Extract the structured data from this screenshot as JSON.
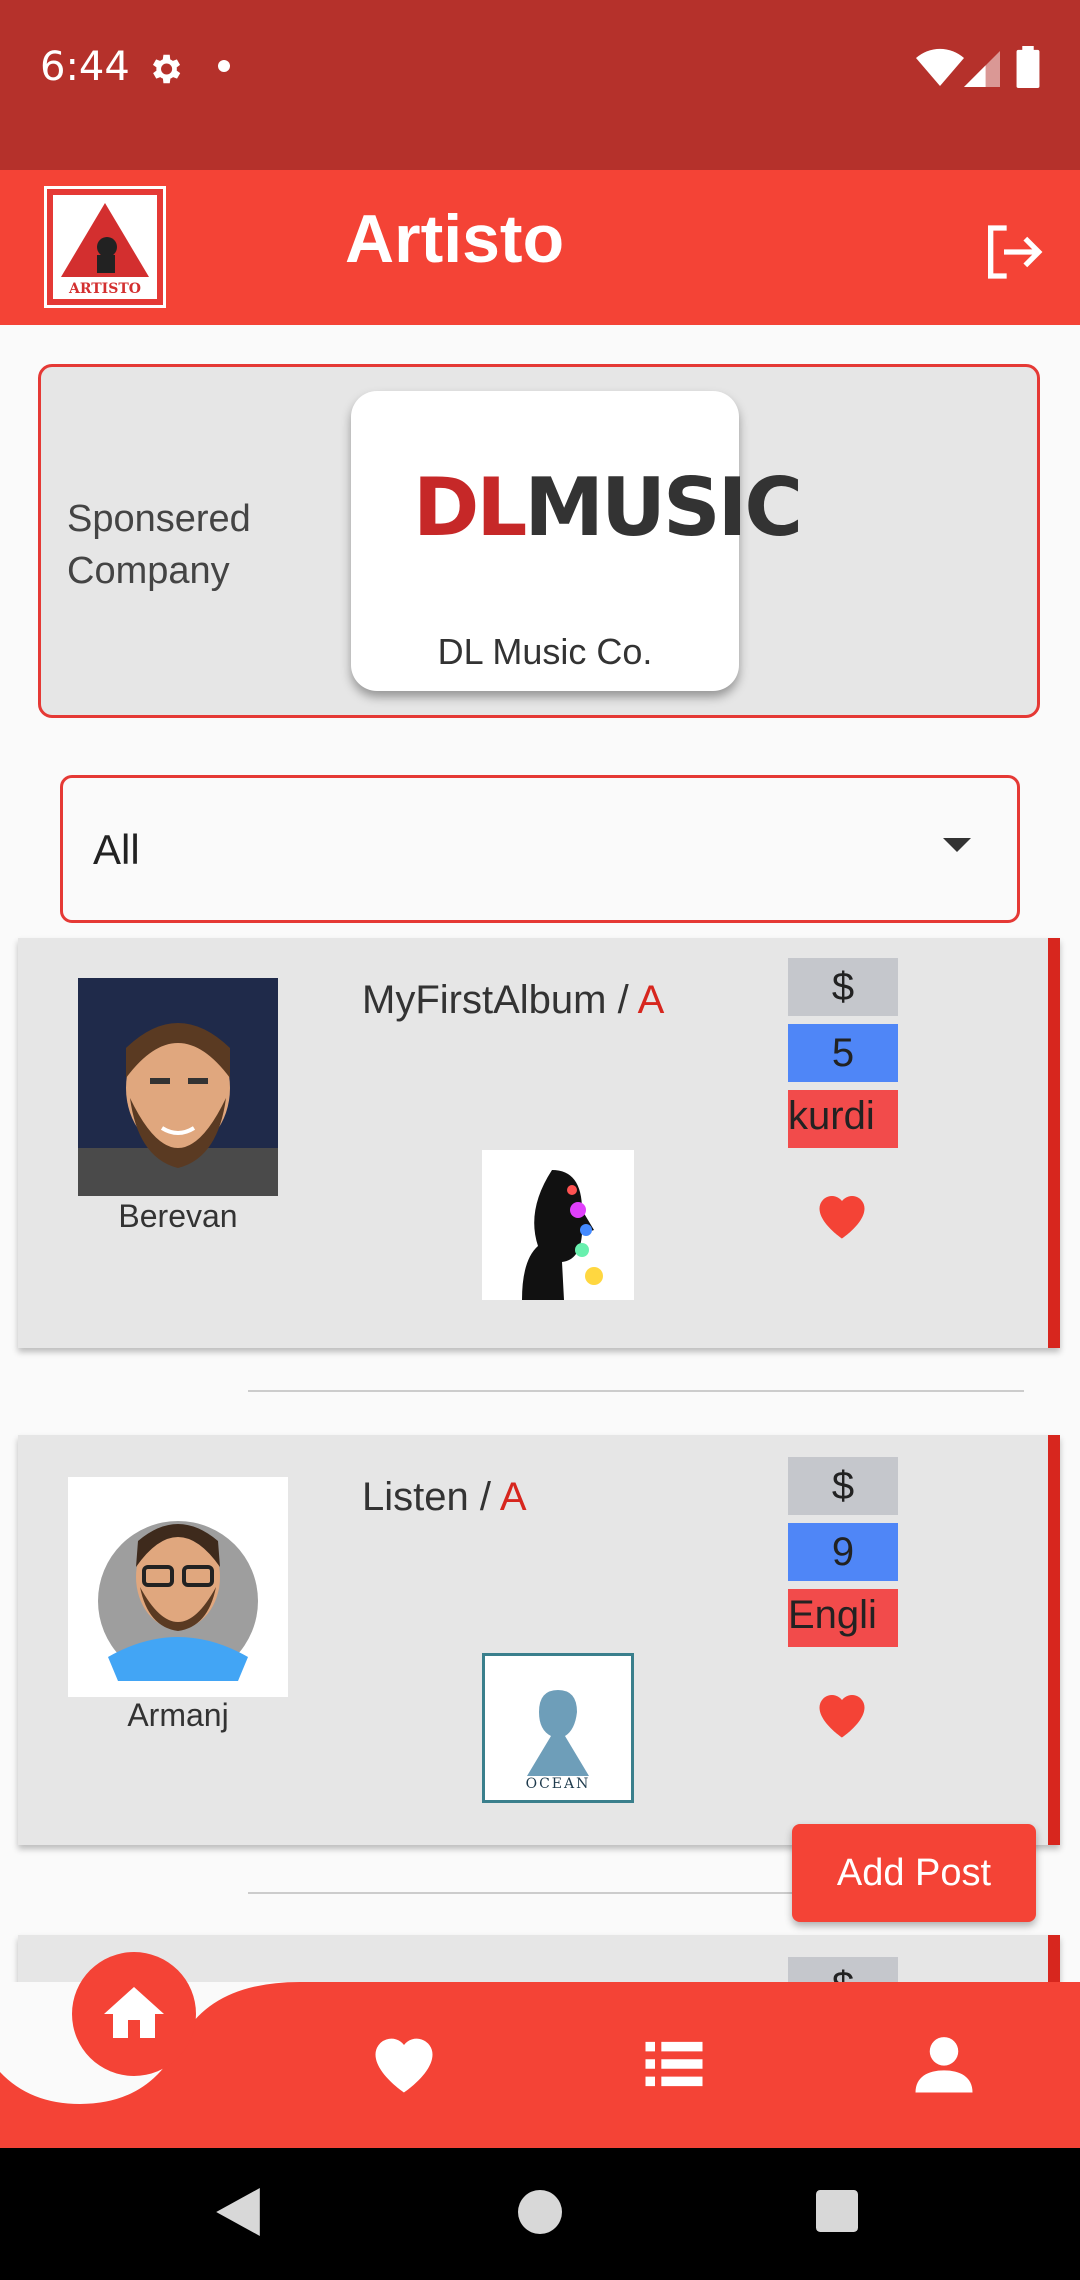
{
  "status_bar": {
    "time": "6:44"
  },
  "app_bar": {
    "title": "Artisto",
    "logo_text": "ARTISTO"
  },
  "sponsor": {
    "label": "Sponsered Company",
    "company_logo_text_dl": "DL",
    "company_logo_text_music": "MUSIC",
    "company_name": "DL Music Co."
  },
  "filter": {
    "selected": "All"
  },
  "posts": [
    {
      "author": "Berevan",
      "title": "MyFirstAlbum / ",
      "grade": "A",
      "price_symbol": "$",
      "count": "5",
      "language": "kurdi"
    },
    {
      "author": "Armanj",
      "title": "Listen / ",
      "grade": "A",
      "price_symbol": "$",
      "count": "9",
      "language": "Engli"
    },
    {
      "author": "",
      "title": "",
      "grade": "",
      "price_symbol": "$",
      "count": "",
      "language": ""
    }
  ],
  "fab": {
    "label": "Add Post"
  },
  "colors": {
    "primary": "#f44336",
    "status": "#b5312b",
    "accent_red": "#d7261e",
    "count_blue": "#4f86f7"
  },
  "icons": {
    "settings": "settings-icon",
    "logout": "logout-icon",
    "home": "home-icon",
    "favorites": "heart-icon",
    "list": "list-icon",
    "profile": "person-icon"
  }
}
